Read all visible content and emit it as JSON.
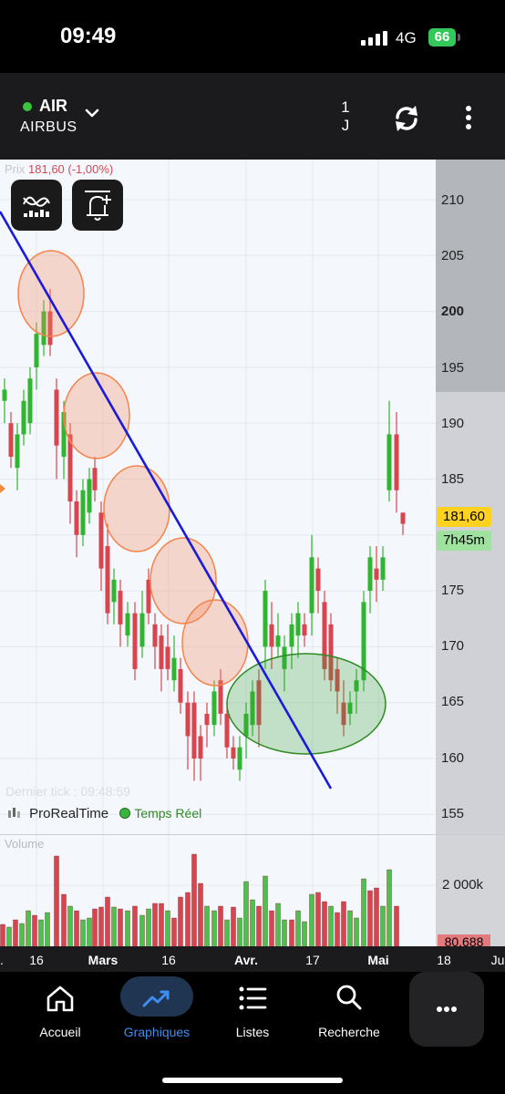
{
  "status_bar": {
    "time": "09:49",
    "network": "4G",
    "battery": "66"
  },
  "header": {
    "ticker": "AIR",
    "company": "AIRBUS",
    "period_line1": "1",
    "period_line2": "J",
    "icons": [
      "chevron-down-icon",
      "sync-icon",
      "more-vertical-icon"
    ]
  },
  "chart": {
    "price_label": "Prix",
    "price_value": "181,60 (-1,00%)",
    "tools": [
      "indicators-icon",
      "alert-bell-icon"
    ],
    "price_ticks": [
      "210",
      "205",
      "200",
      "195",
      "190",
      "185",
      "175",
      "170",
      "165",
      "160",
      "155"
    ],
    "current_price": "181,60",
    "time_left": "7h45m",
    "last_tick": "Dernier tick : 09:48:59",
    "brand": "ProRealTime",
    "realtime": "Temps Réel",
    "colors": {
      "up": "#2fb52f",
      "down": "#d9454f",
      "trendline": "#1a1adb",
      "highlight_orange": "#f4844c",
      "highlight_green": "#2e8a21"
    }
  },
  "volume": {
    "label": "Volume",
    "tick": "2 000k",
    "current": "80,688"
  },
  "date_axis": [
    "16",
    "Mars",
    "16",
    "Avr.",
    "17",
    "Mai",
    "18",
    "Ju"
  ],
  "tabbar": {
    "tabs": [
      {
        "label": "Accueil",
        "icon": "home-icon"
      },
      {
        "label": "Graphiques",
        "icon": "chart-trend-icon",
        "active": true
      },
      {
        "label": "Listes",
        "icon": "list-icon"
      },
      {
        "label": "Recherche",
        "icon": "search-icon"
      }
    ],
    "more_icon": "more-horizontal-icon"
  }
}
